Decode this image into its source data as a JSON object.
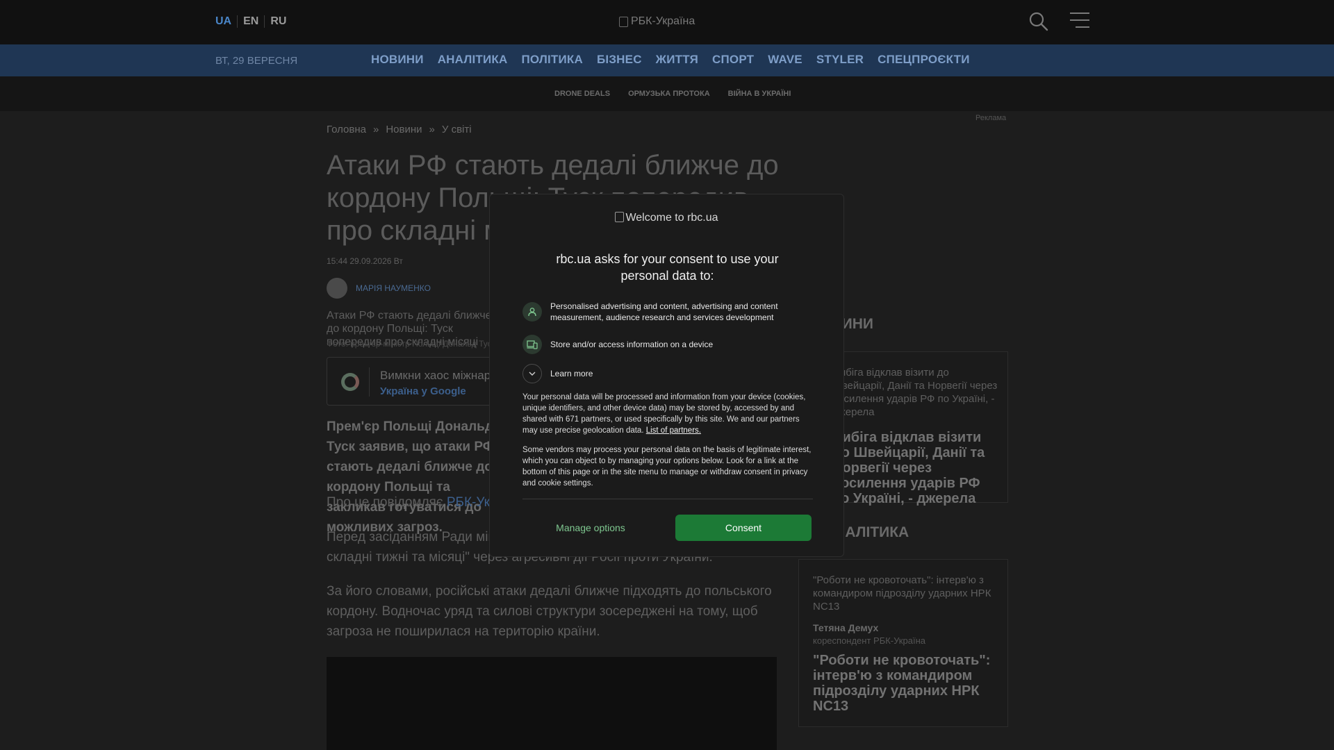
{
  "header": {
    "languages": [
      "UA",
      "EN",
      "RU"
    ],
    "logo_alt": "РБК-Україна"
  },
  "nav": {
    "date": "ВТ, 29 ВЕРЕСНЯ",
    "links": [
      "НОВИНИ",
      "АНАЛІТИКА",
      "ПОЛІТИКА",
      "БІЗНЕС",
      "ЖИТТЯ",
      "СПОРТ",
      "WAVE",
      "STYLER",
      "СПЕЦПРОЄКТИ"
    ]
  },
  "subnav": {
    "links": [
      "DRONE DEALS",
      "ОРМУЗЬКА ПРОТОКА",
      "ВІЙНА В УКРАЇНІ"
    ]
  },
  "ad_label": "Реклама",
  "breadcrumb": [
    "Головна",
    "Новини",
    "У світі"
  ],
  "breadcrumb_sep": "»",
  "article": {
    "title": "Атаки РФ стають дедалі ближче до кордону Польщі: Туск попередив про складні місяці",
    "time": "15:44 29.09.2026 Вт",
    "author": "МАРІЯ НАУМЕНКО",
    "photo_alt": "Атаки РФ стають дедалі ближче до кордону Польщі: Туск попередив про складні місяці",
    "photo_caption": "Фото: прем'єр-міністр Польщі Дональд Туск",
    "google_box_text": "Вимкни хаос міжнародних новин",
    "google_box_link": "Україна у Google",
    "lead": "Прем'єр Польщі Дональд Туск заявив, що атаки РФ стають дедалі ближче до кордону Польщі та закликав готуватися до можливих загроз.",
    "p1_text": "Про це повідомляє ",
    "p1_link": "РБК-Україна",
    "p2": "Перед засіданням Ради міністрів Туск наголосив, що попереду \"дуже складні тижні та місяці\" через агресивні дії Росії проти України.",
    "p3": "За його словами, російські атаки дедалі ближче підходять до польського кордону. Водночас уряд та силові структури зосереджені на тому, щоб загроза не поширилася на територію країни."
  },
  "sidebar": {
    "section1_title": "НОВИНИ",
    "card1_alt": "Сибіга відклав візити до Швейцарії, Данії та Норвегії через посилення ударів РФ по Україні, - джерела",
    "card1_headline": "Сибіга відклав візити до Швейцарії, Данії та Норвегії через посилення ударів РФ по Україні, - джерела",
    "section2_title": "АНАЛІТИКА",
    "card2_alt": "\"Роботи не кровоточать\": інтерв'ю з командиром підрозділу ударних НРК NC13",
    "card2_author": "Тетяна Демух",
    "card2_role": "кореспондент РБК-Україна",
    "card2_headline": "\"Роботи не кровоточать\": інтерв'ю з командиром підрозділу ударних НРК NC13"
  },
  "consent": {
    "logo_alt": "Welcome to rbc.ua",
    "heading": "rbc.ua asks for your consent to use your personal data to:",
    "purpose1": "Personalised advertising and content, advertising and content measurement, audience research and services development",
    "purpose2": "Store and/or access information on a device",
    "learn_more": "Learn more",
    "text1": "Your personal data will be processed and information from your device (cookies, unique identifiers, and other device data) may be stored by, accessed by and shared with 671 partners, or used specifically by this site. We and our partners may use precise geolocation data. ",
    "partners_link": "List of partners.",
    "text2": "Some vendors may process your personal data on the basis of legitimate interest, which you can object to by managing your options below. Look for a link at the bottom of this page or in the site menu to manage or withdraw consent in privacy and cookie settings.",
    "manage_label": "Manage options",
    "consent_label": "Consent",
    "accent_color": "#1c7a36"
  }
}
